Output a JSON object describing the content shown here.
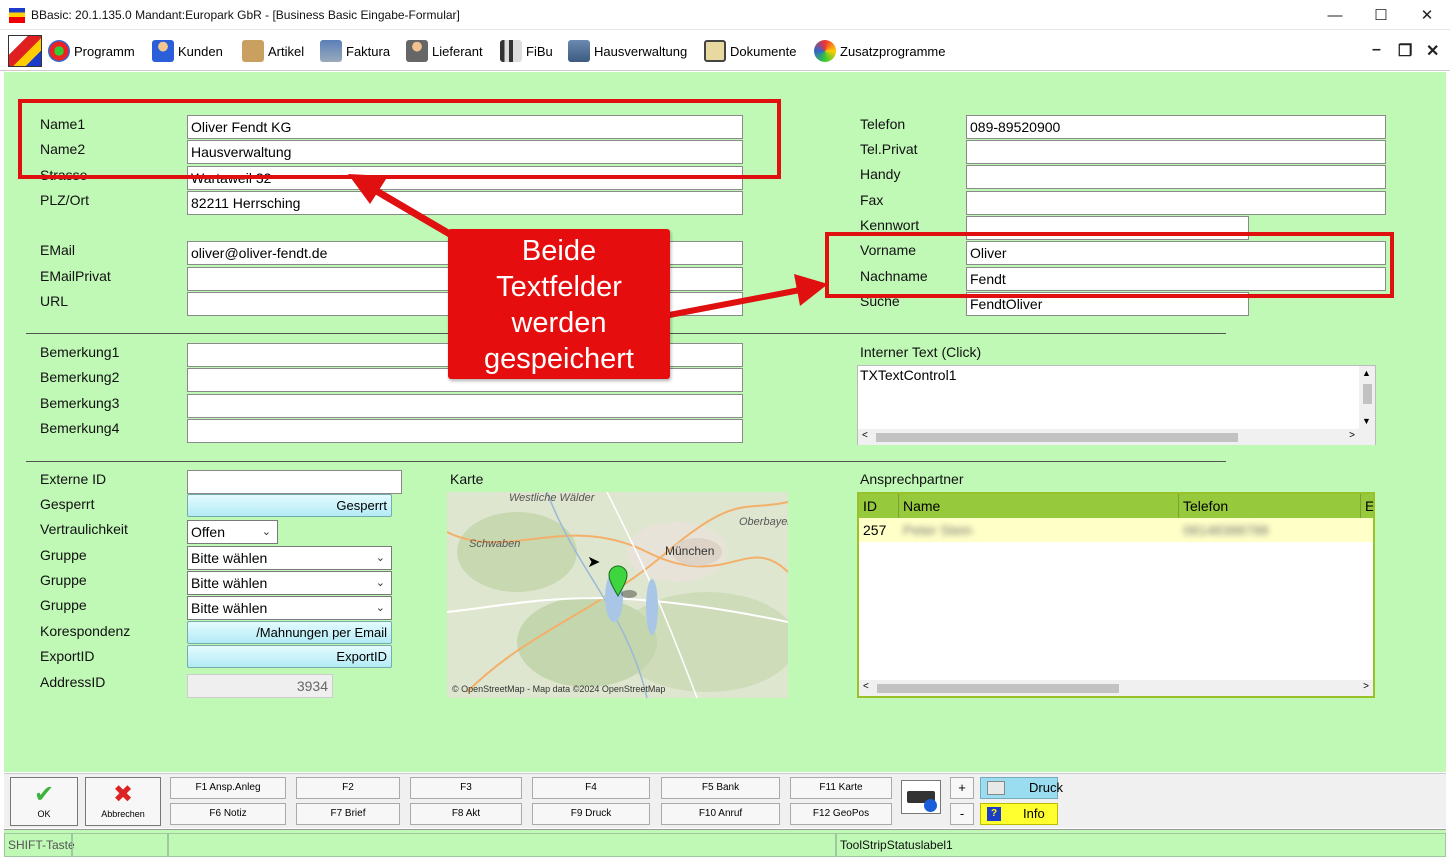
{
  "window": {
    "title": "BBasic: 20.1.135.0 Mandant:Europark GbR  - [Business Basic Eingabe-Formular]"
  },
  "menu": [
    {
      "label": "Programm",
      "icon": "programm-icon"
    },
    {
      "label": "Kunden",
      "icon": "kunden-icon"
    },
    {
      "label": "Artikel",
      "icon": "artikel-icon"
    },
    {
      "label": "Faktura",
      "icon": "faktura-icon"
    },
    {
      "label": "Lieferant",
      "icon": "lieferant-icon"
    },
    {
      "label": "FiBu",
      "icon": "fibu-icon"
    },
    {
      "label": "Hausverwaltung",
      "icon": "hausverwaltung-icon"
    },
    {
      "label": "Dokumente",
      "icon": "dokumente-icon"
    },
    {
      "label": "Zusatzprogramme",
      "icon": "zusatzprogramme-icon"
    }
  ],
  "left": {
    "name1": {
      "label": "Name1",
      "value": "Oliver Fendt KG"
    },
    "name2": {
      "label": "Name2",
      "value": "Hausverwaltung"
    },
    "strasse": {
      "label": "Strasse",
      "value": "Wartaweil 32"
    },
    "plzort": {
      "label": "PLZ/Ort",
      "value": "82211 Herrsching"
    },
    "email": {
      "label": "EMail",
      "value": "oliver@oliver-fendt.de"
    },
    "emailprivat": {
      "label": "EMailPrivat",
      "value": ""
    },
    "url": {
      "label": "URL",
      "value": ""
    },
    "bem1": {
      "label": "Bemerkung1",
      "value": ""
    },
    "bem2": {
      "label": "Bemerkung2",
      "value": ""
    },
    "bem3": {
      "label": "Bemerkung3",
      "value": ""
    },
    "bem4": {
      "label": "Bemerkung4",
      "value": ""
    }
  },
  "right": {
    "telefon": {
      "label": "Telefon",
      "value": "089-89520900"
    },
    "telprivat": {
      "label": "Tel.Privat",
      "value": ""
    },
    "handy": {
      "label": "Handy",
      "value": ""
    },
    "fax": {
      "label": "Fax",
      "value": ""
    },
    "kennwort": {
      "label": "Kennwort",
      "value": ""
    },
    "vorname": {
      "label": "Vorname",
      "value": "Oliver"
    },
    "nachname": {
      "label": "Nachname",
      "value": "Fendt"
    },
    "suche": {
      "label": "Suche",
      "value": "FendtOliver"
    },
    "interner_text": {
      "label": "Interner Text (Click)",
      "value": "TXTextControl1"
    }
  },
  "lower": {
    "externe_id": {
      "label": "Externe ID",
      "value": ""
    },
    "gesperrt": {
      "label": "Gesperrt",
      "button": "Gesperrt"
    },
    "vertraulichkeit": {
      "label": "Vertraulichkeit",
      "value": "Offen"
    },
    "gruppe1": {
      "label": "Gruppe",
      "value": "Bitte wählen"
    },
    "gruppe2": {
      "label": "Gruppe",
      "value": "Bitte wählen"
    },
    "gruppe3": {
      "label": "Gruppe",
      "value": "Bitte wählen"
    },
    "korrespondenz": {
      "label": "Korespondenz",
      "button": "/Mahnungen per Email"
    },
    "exportid": {
      "label": "ExportID",
      "button": "ExportID"
    },
    "addressid": {
      "label": "AddressID",
      "value": "3934"
    }
  },
  "map": {
    "label": "Karte",
    "places": [
      "Westliche Wälder",
      "Schwaben",
      "München",
      "Oberbayern"
    ],
    "attribution": "© OpenStreetMap - Map data ©2024 OpenStreetMap"
  },
  "contacts": {
    "label": "Ansprechpartner",
    "columns": [
      "ID",
      "Name",
      "Telefon",
      "E"
    ],
    "rows": [
      {
        "id": "257",
        "name": "Peter Stein",
        "telefon": "08148388788"
      }
    ]
  },
  "callout": {
    "lines": [
      "Beide",
      "Textfelder",
      "werden",
      "gespeichert"
    ],
    "color": "#e50d0d"
  },
  "toolbar": {
    "ok": "OK",
    "abbrechen": "Abbrechen",
    "fkeys_top": [
      "F1 Ansp.Anleg",
      "F2",
      "F3",
      "F4",
      "F5 Bank",
      "F11 Karte"
    ],
    "fkeys_bottom": [
      "F6 Notiz",
      "F7 Brief",
      "F8 Akt",
      "F9 Druck",
      "F10 Anruf",
      "F12 GeoPos"
    ],
    "plus": "+",
    "minus": "-",
    "druck": "Druck",
    "info": "Info"
  },
  "status": {
    "shift": "SHIFT-Taste",
    "label": "ToolStripStatuslabel1"
  }
}
